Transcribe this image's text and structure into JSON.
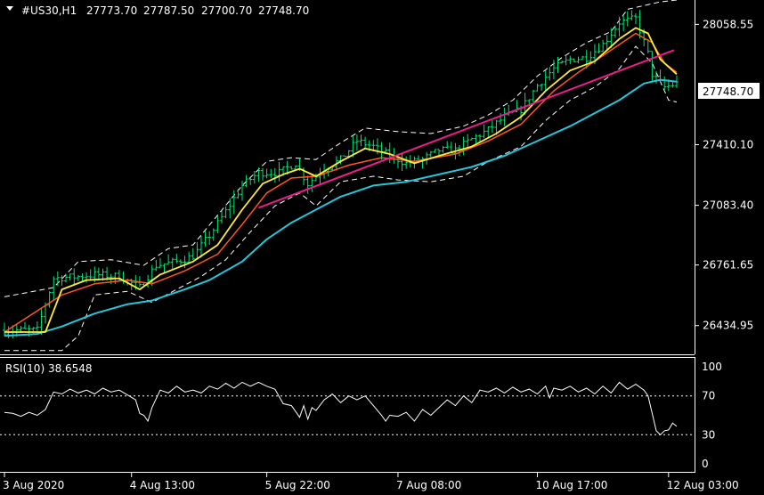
{
  "chart_data": [
    {
      "type": "candlestick",
      "symbol_timeframe": "#US30,H1",
      "ohlc_header": [
        "27773.70",
        "27787.50",
        "27700.70",
        "27748.70"
      ],
      "current_price_label": "27748.70",
      "ylim": [
        26280,
        28190
      ],
      "yticks": [
        28058.55,
        27410.1,
        27083.4,
        26761.65,
        26434.95
      ],
      "ytick_labels": [
        "28058.55",
        "27410.10",
        "27083.40",
        "26761.65",
        "26434.95"
      ],
      "xtick_labels": [
        "3 Aug 2020",
        "4 Aug 13:00",
        "5 Aug 22:00",
        "7 Aug 08:00",
        "10 Aug 17:00",
        "12 Aug 03:00"
      ],
      "xtick_bars": [
        0,
        31,
        64,
        96,
        130,
        162
      ],
      "bar_count": 165,
      "price_path": [
        [
          0,
          26410
        ],
        [
          8,
          26410
        ],
        [
          12,
          26690
        ],
        [
          18,
          26700
        ],
        [
          22,
          26710
        ],
        [
          28,
          26700
        ],
        [
          33,
          26640
        ],
        [
          37,
          26760
        ],
        [
          42,
          26780
        ],
        [
          46,
          26810
        ],
        [
          50,
          26920
        ],
        [
          54,
          27050
        ],
        [
          58,
          27190
        ],
        [
          62,
          27260
        ],
        [
          67,
          27260
        ],
        [
          71,
          27310
        ],
        [
          74,
          27200
        ],
        [
          78,
          27280
        ],
        [
          82,
          27330
        ],
        [
          86,
          27430
        ],
        [
          90,
          27400
        ],
        [
          94,
          27350
        ],
        [
          98,
          27310
        ],
        [
          102,
          27330
        ],
        [
          106,
          27380
        ],
        [
          110,
          27380
        ],
        [
          114,
          27440
        ],
        [
          118,
          27490
        ],
        [
          122,
          27560
        ],
        [
          126,
          27600
        ],
        [
          130,
          27730
        ],
        [
          134,
          27820
        ],
        [
          138,
          27870
        ],
        [
          142,
          27880
        ],
        [
          146,
          27950
        ],
        [
          150,
          28070
        ],
        [
          154,
          28090
        ],
        [
          157,
          27900
        ],
        [
          158,
          27790
        ],
        [
          161,
          27720
        ],
        [
          164,
          27740
        ]
      ],
      "moving_average_fast": {
        "color": "#ffeb3b",
        "values": [
          [
            0,
            26400
          ],
          [
            10,
            26400
          ],
          [
            14,
            26630
          ],
          [
            20,
            26680
          ],
          [
            28,
            26690
          ],
          [
            33,
            26630
          ],
          [
            38,
            26710
          ],
          [
            46,
            26780
          ],
          [
            52,
            26870
          ],
          [
            58,
            27060
          ],
          [
            63,
            27200
          ],
          [
            68,
            27250
          ],
          [
            72,
            27280
          ],
          [
            76,
            27240
          ],
          [
            82,
            27320
          ],
          [
            88,
            27390
          ],
          [
            94,
            27360
          ],
          [
            100,
            27310
          ],
          [
            106,
            27350
          ],
          [
            114,
            27400
          ],
          [
            120,
            27470
          ],
          [
            126,
            27560
          ],
          [
            132,
            27700
          ],
          [
            138,
            27810
          ],
          [
            144,
            27860
          ],
          [
            150,
            27980
          ],
          [
            154,
            28040
          ],
          [
            157,
            28010
          ],
          [
            160,
            27870
          ],
          [
            164,
            27790
          ]
        ]
      },
      "moving_average_medium": {
        "color": "#ff5722",
        "values": [
          [
            0,
            26400
          ],
          [
            14,
            26600
          ],
          [
            22,
            26660
          ],
          [
            30,
            26680
          ],
          [
            36,
            26660
          ],
          [
            44,
            26730
          ],
          [
            52,
            26820
          ],
          [
            58,
            26980
          ],
          [
            64,
            27150
          ],
          [
            70,
            27230
          ],
          [
            76,
            27240
          ],
          [
            84,
            27300
          ],
          [
            92,
            27340
          ],
          [
            100,
            27320
          ],
          [
            110,
            27360
          ],
          [
            118,
            27430
          ],
          [
            126,
            27520
          ],
          [
            134,
            27700
          ],
          [
            140,
            27800
          ],
          [
            148,
            27920
          ],
          [
            154,
            28010
          ],
          [
            158,
            27960
          ],
          [
            161,
            27850
          ],
          [
            164,
            27800
          ]
        ]
      },
      "moving_average_slow": {
        "color": "#26c6da",
        "values": [
          [
            0,
            26380
          ],
          [
            8,
            26390
          ],
          [
            14,
            26430
          ],
          [
            22,
            26500
          ],
          [
            30,
            26550
          ],
          [
            36,
            26570
          ],
          [
            44,
            26630
          ],
          [
            50,
            26680
          ],
          [
            58,
            26780
          ],
          [
            64,
            26900
          ],
          [
            70,
            26990
          ],
          [
            76,
            27060
          ],
          [
            82,
            27130
          ],
          [
            90,
            27190
          ],
          [
            98,
            27210
          ],
          [
            106,
            27250
          ],
          [
            114,
            27290
          ],
          [
            122,
            27350
          ],
          [
            130,
            27430
          ],
          [
            138,
            27510
          ],
          [
            144,
            27580
          ],
          [
            150,
            27650
          ],
          [
            156,
            27740
          ],
          [
            160,
            27760
          ],
          [
            164,
            27750
          ]
        ]
      },
      "envelope_upper": {
        "color": "#ffffff",
        "values": [
          [
            0,
            26590
          ],
          [
            12,
            26640
          ],
          [
            18,
            26780
          ],
          [
            26,
            26790
          ],
          [
            34,
            26760
          ],
          [
            40,
            26850
          ],
          [
            46,
            26870
          ],
          [
            52,
            27030
          ],
          [
            58,
            27190
          ],
          [
            64,
            27320
          ],
          [
            70,
            27340
          ],
          [
            76,
            27330
          ],
          [
            82,
            27420
          ],
          [
            88,
            27500
          ],
          [
            96,
            27480
          ],
          [
            104,
            27470
          ],
          [
            112,
            27510
          ],
          [
            118,
            27570
          ],
          [
            124,
            27650
          ],
          [
            130,
            27780
          ],
          [
            136,
            27880
          ],
          [
            142,
            27960
          ],
          [
            148,
            28020
          ],
          [
            152,
            28140
          ],
          [
            156,
            28160
          ],
          [
            160,
            28180
          ],
          [
            164,
            28190
          ]
        ]
      },
      "envelope_lower": {
        "color": "#ffffff",
        "values": [
          [
            0,
            26300
          ],
          [
            14,
            26300
          ],
          [
            18,
            26380
          ],
          [
            22,
            26600
          ],
          [
            30,
            26620
          ],
          [
            36,
            26560
          ],
          [
            42,
            26630
          ],
          [
            48,
            26700
          ],
          [
            54,
            26790
          ],
          [
            60,
            26940
          ],
          [
            66,
            27080
          ],
          [
            72,
            27150
          ],
          [
            76,
            27080
          ],
          [
            82,
            27210
          ],
          [
            90,
            27240
          ],
          [
            96,
            27220
          ],
          [
            104,
            27210
          ],
          [
            112,
            27240
          ],
          [
            118,
            27320
          ],
          [
            126,
            27400
          ],
          [
            132,
            27540
          ],
          [
            138,
            27650
          ],
          [
            144,
            27720
          ],
          [
            150,
            27820
          ],
          [
            154,
            27940
          ],
          [
            158,
            27850
          ],
          [
            162,
            27650
          ],
          [
            164,
            27640
          ]
        ]
      },
      "trendline": {
        "color": "#e91e8c",
        "from": [
          62,
          27070
        ],
        "to": [
          172,
          27920
        ]
      }
    },
    {
      "type": "line",
      "indicator_label": "RSI(10) 38.6548",
      "ylim": [
        0,
        100
      ],
      "yticks": [
        100,
        70,
        30,
        0
      ],
      "ytick_labels": [
        "100",
        "70",
        "30",
        "0"
      ],
      "levels": [
        70,
        30
      ],
      "values": [
        [
          0,
          53
        ],
        [
          2,
          52
        ],
        [
          4,
          49
        ],
        [
          6,
          53
        ],
        [
          8,
          50
        ],
        [
          10,
          56
        ],
        [
          12,
          74
        ],
        [
          14,
          72
        ],
        [
          16,
          77
        ],
        [
          18,
          73
        ],
        [
          20,
          76
        ],
        [
          22,
          72
        ],
        [
          24,
          78
        ],
        [
          26,
          74
        ],
        [
          28,
          76
        ],
        [
          30,
          71
        ],
        [
          32,
          66
        ],
        [
          33,
          52
        ],
        [
          34,
          50
        ],
        [
          35,
          44
        ],
        [
          36,
          58
        ],
        [
          38,
          76
        ],
        [
          40,
          73
        ],
        [
          42,
          80
        ],
        [
          44,
          74
        ],
        [
          46,
          76
        ],
        [
          48,
          73
        ],
        [
          50,
          80
        ],
        [
          52,
          77
        ],
        [
          54,
          83
        ],
        [
          56,
          78
        ],
        [
          58,
          84
        ],
        [
          60,
          80
        ],
        [
          62,
          84
        ],
        [
          64,
          80
        ],
        [
          66,
          77
        ],
        [
          68,
          62
        ],
        [
          70,
          60
        ],
        [
          71,
          54
        ],
        [
          72,
          48
        ],
        [
          73,
          60
        ],
        [
          74,
          46
        ],
        [
          75,
          58
        ],
        [
          76,
          55
        ],
        [
          78,
          66
        ],
        [
          80,
          72
        ],
        [
          82,
          63
        ],
        [
          84,
          70
        ],
        [
          86,
          66
        ],
        [
          88,
          70
        ],
        [
          90,
          60
        ],
        [
          92,
          50
        ],
        [
          93,
          44
        ],
        [
          94,
          50
        ],
        [
          96,
          49
        ],
        [
          98,
          53
        ],
        [
          100,
          44
        ],
        [
          102,
          56
        ],
        [
          104,
          50
        ],
        [
          106,
          58
        ],
        [
          108,
          66
        ],
        [
          110,
          60
        ],
        [
          112,
          70
        ],
        [
          114,
          63
        ],
        [
          116,
          76
        ],
        [
          118,
          74
        ],
        [
          120,
          78
        ],
        [
          122,
          73
        ],
        [
          124,
          79
        ],
        [
          126,
          74
        ],
        [
          128,
          77
        ],
        [
          130,
          72
        ],
        [
          132,
          80
        ],
        [
          133,
          68
        ],
        [
          134,
          78
        ],
        [
          136,
          76
        ],
        [
          138,
          80
        ],
        [
          140,
          74
        ],
        [
          142,
          78
        ],
        [
          144,
          72
        ],
        [
          146,
          80
        ],
        [
          148,
          73
        ],
        [
          150,
          84
        ],
        [
          152,
          77
        ],
        [
          154,
          82
        ],
        [
          156,
          76
        ],
        [
          157,
          70
        ],
        [
          158,
          52
        ],
        [
          159,
          34
        ],
        [
          160,
          30
        ],
        [
          161,
          34
        ],
        [
          162,
          35
        ],
        [
          163,
          42
        ],
        [
          164,
          38.65
        ]
      ]
    }
  ]
}
